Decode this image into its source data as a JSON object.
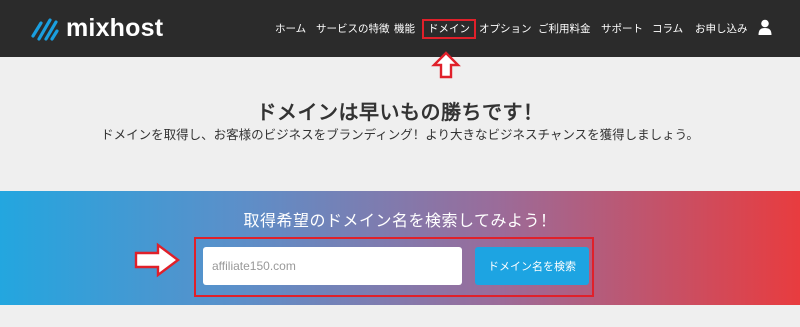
{
  "brand": {
    "name": "mixhost"
  },
  "nav": {
    "items": [
      {
        "label": "ホーム"
      },
      {
        "label": "サービスの特徴"
      },
      {
        "label": "機能"
      },
      {
        "label": "ドメイン",
        "highlighted": true
      },
      {
        "label": "オプション"
      },
      {
        "label": "ご利用料金"
      },
      {
        "label": "サポート"
      },
      {
        "label": "コラム"
      },
      {
        "label": "お申し込み"
      }
    ],
    "user_icon": "user-icon"
  },
  "hero": {
    "headline": "ドメインは早いもの勝ちです！",
    "subtext": "ドメインを取得し、お客様のビジネスをブランディング！より大きなビジネスチャンスを獲得しましょう。"
  },
  "search": {
    "title": "取得希望のドメイン名を検索してみよう！",
    "input_value": "affiliate150.com",
    "button_label": "ドメイン名を検索"
  },
  "colors": {
    "navbar": "#2b2b2b",
    "highlight": "#e0202a",
    "button": "#1da4e2",
    "gradient_start": "#23a6df",
    "gradient_end": "#e83c3f"
  }
}
